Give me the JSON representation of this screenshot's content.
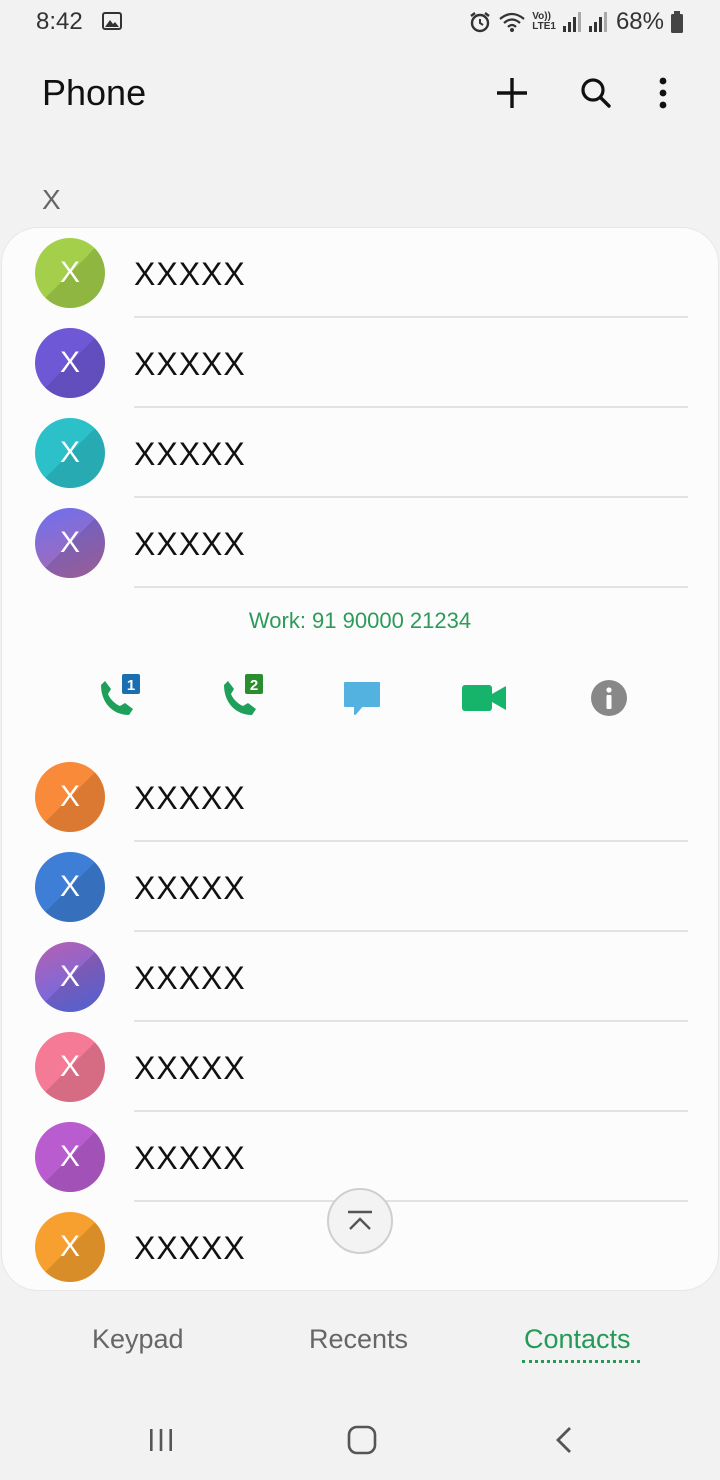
{
  "status": {
    "time": "8:42",
    "network_label_top": "Vo))",
    "network_label_bottom": "LTE1",
    "battery": "68%"
  },
  "header": {
    "title": "Phone",
    "add_icon": "plus-icon",
    "search_icon": "search-icon",
    "more_icon": "more-vertical-icon"
  },
  "section_label": "X",
  "contacts_top": [
    {
      "initial": "X",
      "name": "XXXXX",
      "color": "#a3cf4a"
    },
    {
      "initial": "X",
      "name": "XXXXX",
      "color": "#6f58d6"
    },
    {
      "initial": "X",
      "name": "XXXXX",
      "color": "#2cc1c9"
    },
    {
      "initial": "X",
      "name": "XXXXX",
      "color": "#7f6fe6"
    }
  ],
  "expanded": {
    "phone_text": "Work: 91 90000 21234",
    "sim1_badge": "1",
    "sim2_badge": "2",
    "actions": [
      "call-sim1-icon",
      "call-sim2-icon",
      "message-icon",
      "video-call-icon",
      "info-icon"
    ]
  },
  "contacts_bottom": [
    {
      "initial": "X",
      "name": "XXXXX",
      "color": "#f98a3a"
    },
    {
      "initial": "X",
      "name": "XXXXX",
      "color": "#3e7ed6"
    },
    {
      "initial": "X",
      "name": "XXXXX",
      "color": "#7a63e6"
    },
    {
      "initial": "X",
      "name": "XXXXX",
      "color": "#f47a96"
    },
    {
      "initial": "X",
      "name": "XXXXX",
      "color": "#b85ccf"
    },
    {
      "initial": "X",
      "name": "XXXXX",
      "color": "#f7a02f"
    }
  ],
  "tabs": {
    "keypad": "Keypad",
    "recents": "Recents",
    "contacts": "Contacts"
  },
  "colors": {
    "accent": "#239a56",
    "phone_text": "#2e9a5a",
    "call_green": "#1fa05a",
    "sim1_badge_bg": "#1a6fb0",
    "sim2_badge_bg": "#2a8e2e",
    "message_blue": "#54b2e0",
    "video_green": "#16b46b",
    "info_gray": "#888888"
  }
}
